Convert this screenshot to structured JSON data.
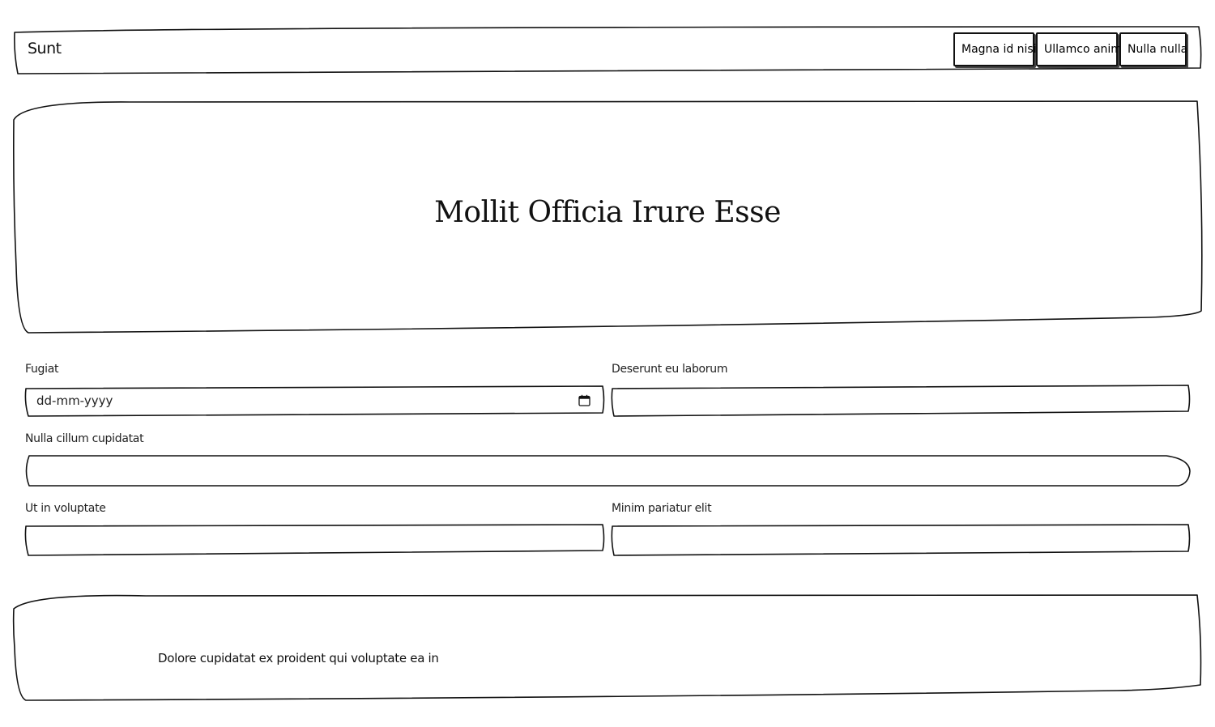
{
  "header": {
    "brand": "Sunt",
    "nav": [
      {
        "label": "Magna id nisi"
      },
      {
        "label": "Ullamco anim"
      },
      {
        "label": "Nulla nulla"
      }
    ]
  },
  "hero": {
    "title": "Mollit Officia Irure Esse"
  },
  "form": {
    "fugiat": {
      "label": "Fugiat",
      "placeholder": "dd-mm-yyyy",
      "value": ""
    },
    "deserunt": {
      "label": "Deserunt eu laborum",
      "value": ""
    },
    "nulla_cillum": {
      "label": "Nulla cillum cupidatat",
      "value": ""
    },
    "ut_in": {
      "label": "Ut in voluptate",
      "value": ""
    },
    "minim": {
      "label": "Minim pariatur elit",
      "value": ""
    }
  },
  "footer": {
    "text": "Dolore cupidatat ex proident qui voluptate ea in"
  },
  "icons": {
    "date_picker": "calendar-icon"
  }
}
